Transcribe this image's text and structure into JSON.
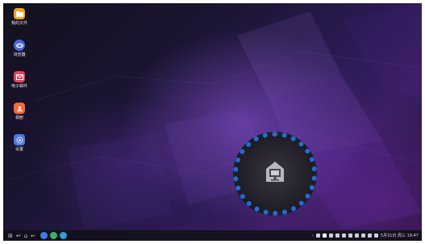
{
  "desktop": {
    "icons": [
      {
        "label": "我的文件",
        "icon": "folder-icon",
        "color": "#f3a21d"
      },
      {
        "label": "浏览器",
        "icon": "internet-icon",
        "color": "#4b67d8"
      },
      {
        "label": "电子邮件",
        "icon": "email-icon",
        "color": "#e3435a"
      },
      {
        "label": "相册",
        "icon": "gallery-icon",
        "color": "#f06a3a"
      },
      {
        "label": "设置",
        "icon": "settings-icon",
        "color": "#4e78e0"
      }
    ]
  },
  "taskbar": {
    "left_buttons": [
      "⊞",
      "↩",
      "⌂",
      "←"
    ],
    "apps": [
      {
        "icon": "internet-app-icon",
        "color": "#3f7be8"
      },
      {
        "icon": "messages-app-icon",
        "color": "#35b36a"
      },
      {
        "icon": "contacts-app-icon",
        "color": "#2f9ed8"
      }
    ],
    "datetime": "5月31日 周三 19:47"
  },
  "callout": {
    "icon": "dex-screen-icon",
    "border_color": "#1c6fd6"
  }
}
